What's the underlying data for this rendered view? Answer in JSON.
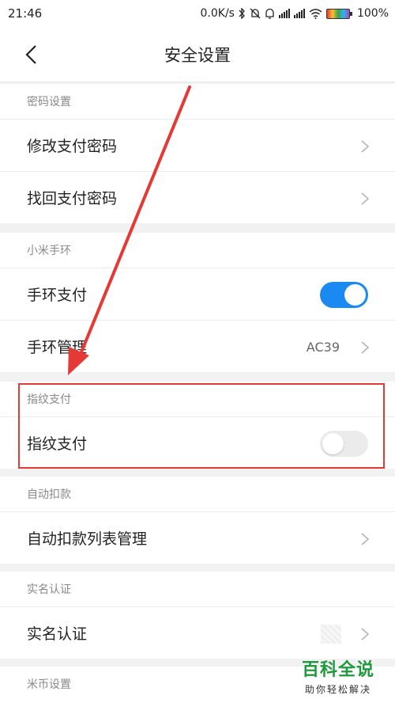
{
  "status_bar": {
    "time": "21:46",
    "network_speed": "0.0K/s",
    "battery_text": "100%"
  },
  "nav": {
    "title": "安全设置"
  },
  "sections": [
    {
      "header": "密码设置",
      "rows": [
        {
          "label": "修改支付密码"
        },
        {
          "label": "找回支付密码"
        }
      ]
    },
    {
      "header": "小米手环",
      "rows": [
        {
          "label": "手环支付",
          "toggle": "on"
        },
        {
          "label": "手环管理",
          "value": "AC39"
        }
      ]
    },
    {
      "header": "指纹支付",
      "rows": [
        {
          "label": "指纹支付",
          "toggle": "off"
        }
      ]
    },
    {
      "header": "自动扣款",
      "rows": [
        {
          "label": "自动扣款列表管理"
        }
      ]
    },
    {
      "header": "实名认证",
      "rows": [
        {
          "label": "实名认证"
        }
      ]
    },
    {
      "header": "米币设置",
      "rows": []
    }
  ],
  "watermark": {
    "title": "百科全说",
    "subtitle": "助你轻松解决"
  },
  "colors": {
    "accent": "#1a8af2",
    "highlight": "#e53935",
    "watermark_green": "#1e9a3c"
  }
}
